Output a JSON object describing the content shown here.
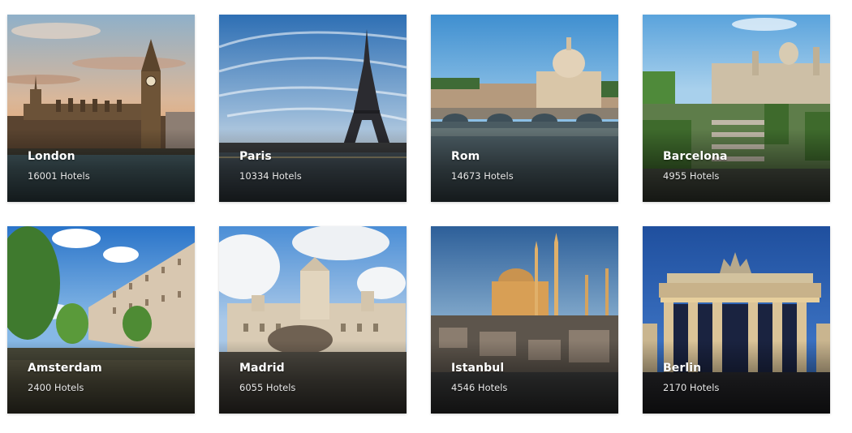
{
  "cities": [
    {
      "name": "London",
      "hotels": "16001 Hotels"
    },
    {
      "name": "Paris",
      "hotels": "10334 Hotels"
    },
    {
      "name": "Rom",
      "hotels": "14673 Hotels"
    },
    {
      "name": "Barcelona",
      "hotels": "4955 Hotels"
    },
    {
      "name": "Amsterdam",
      "hotels": "2400 Hotels"
    },
    {
      "name": "Madrid",
      "hotels": "6055 Hotels"
    },
    {
      "name": "Istanbul",
      "hotels": "4546 Hotels"
    },
    {
      "name": "Berlin",
      "hotels": "2170 Hotels"
    }
  ]
}
